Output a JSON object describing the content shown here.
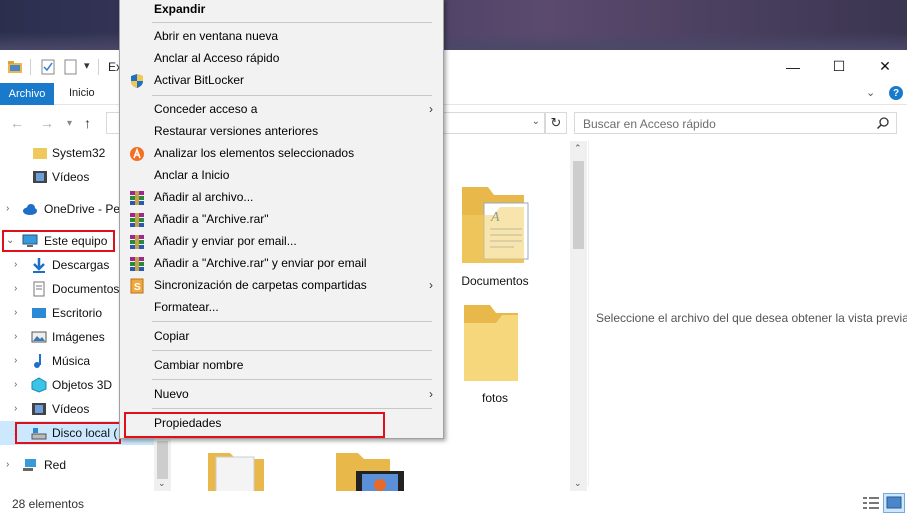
{
  "window": {
    "title": "Ex",
    "minimize": "—",
    "maximize": "☐",
    "close": "✕"
  },
  "ribbon": {
    "tabs": [
      {
        "label": "Archivo"
      },
      {
        "label": "Inicio"
      }
    ],
    "help": "?"
  },
  "nav": {
    "search_placeholder": "Buscar en Acceso rápido"
  },
  "sidebar": {
    "items": [
      {
        "label": "System32",
        "icon": "folder-icon"
      },
      {
        "label": "Vídeos",
        "icon": "video-folder-icon"
      },
      {
        "label": "OneDrive - Per",
        "icon": "cloud-icon"
      },
      {
        "label": "Este equipo",
        "icon": "computer-icon"
      },
      {
        "label": "Descargas",
        "icon": "download-icon"
      },
      {
        "label": "Documentos",
        "icon": "documents-icon"
      },
      {
        "label": "Escritorio",
        "icon": "desktop-icon"
      },
      {
        "label": "Imágenes",
        "icon": "pictures-icon"
      },
      {
        "label": "Música",
        "icon": "music-icon"
      },
      {
        "label": "Objetos 3D",
        "icon": "objects3d-icon"
      },
      {
        "label": "Vídeos",
        "icon": "video-folder-icon"
      },
      {
        "label": "Disco local (",
        "icon": "drive-icon"
      },
      {
        "label": "Red",
        "icon": "network-icon"
      }
    ]
  },
  "content": {
    "items": [
      {
        "label": "Documentos"
      },
      {
        "label": "fotos"
      }
    ]
  },
  "preview": {
    "message": "Seleccione el archivo del que desea obtener la vista previa."
  },
  "status": {
    "count": "28 elementos"
  },
  "context_menu": {
    "items": [
      {
        "label": "Expandir",
        "bold": true
      },
      {
        "label": "Abrir en ventana nueva"
      },
      {
        "label": "Anclar al Acceso rápido"
      },
      {
        "label": "Activar BitLocker",
        "icon": "shield-icon"
      },
      {
        "label": "Conceder acceso a",
        "submenu": true
      },
      {
        "label": "Restaurar versiones anteriores"
      },
      {
        "label": "Analizar los elementos seleccionados",
        "icon": "avast-icon"
      },
      {
        "label": "Anclar a Inicio"
      },
      {
        "label": "Añadir al archivo...",
        "icon": "winrar-icon"
      },
      {
        "label": "Añadir a \"Archive.rar\"",
        "icon": "winrar-icon"
      },
      {
        "label": "Añadir y enviar por email...",
        "icon": "winrar-icon"
      },
      {
        "label": "Añadir a \"Archive.rar\" y enviar por email",
        "icon": "winrar-icon"
      },
      {
        "label": "Sincronización de carpetas compartidas",
        "icon": "sync-icon",
        "submenu": true
      },
      {
        "label": "Formatear..."
      },
      {
        "label": "Copiar"
      },
      {
        "label": "Cambiar nombre"
      },
      {
        "label": "Nuevo",
        "submenu": true
      },
      {
        "label": "Propiedades"
      }
    ]
  },
  "colors": {
    "accent": "#1979ca",
    "highlight": "#e0101a",
    "selection": "#cce8ff",
    "menu_bg": "#f2f2f2"
  }
}
